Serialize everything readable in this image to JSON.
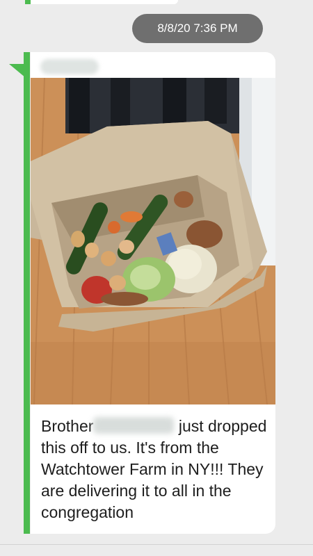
{
  "conversation": {
    "timestamp": "8/8/20 7:36 PM"
  },
  "message": {
    "sender_label": "",
    "photo_caption": "",
    "text_before_name": "Brother",
    "text_after_name": " just dropped this off to us. It's from the Watchtower Farm in NY!!! They are delivering it to all in the congregation"
  },
  "colors": {
    "accent_green": "#4cbb4f",
    "timestamp_bg": "#6f6f6f",
    "background": "#ececec"
  }
}
